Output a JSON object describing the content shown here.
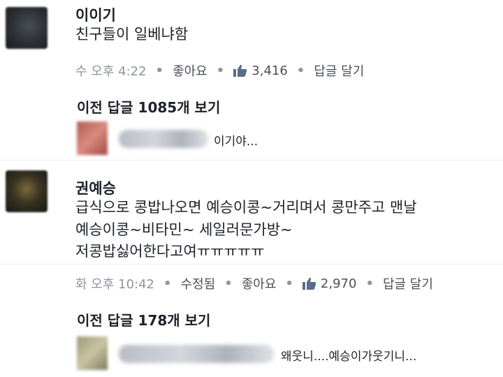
{
  "comments": [
    {
      "author": "이이기",
      "lines": [
        "친구들이 일베냐함"
      ],
      "meta": {
        "time": "수 오후 4:22",
        "like": "좋아요",
        "like_count": "3,416",
        "reply": "답글 달기"
      },
      "prev_replies": "이전 답글 1085개 보기",
      "reply_preview": "이기야..."
    },
    {
      "author": "권예승",
      "lines": [
        "급식으로 콩밥나오면 예승이콩~거리며서 콩만주고 맨날",
        "예승이콩~비타민~ 세일러문가방~",
        "저콩밥싫어한다고여ㅠㅠㅠㅠㅠ"
      ],
      "meta": {
        "time": "화 오후 10:42",
        "edited": "수정됨",
        "like": "좋아요",
        "like_count": "2,970",
        "reply": "답글 달기"
      },
      "prev_replies": "이전 답글 178개 보기",
      "reply_preview": "왜웃니....예승이가웃기니..."
    }
  ],
  "colors": {
    "text": "#1d2129",
    "meta": "#90949c",
    "link": "#4b4f56"
  },
  "icons": [
    "thumbs-up-icon"
  ]
}
